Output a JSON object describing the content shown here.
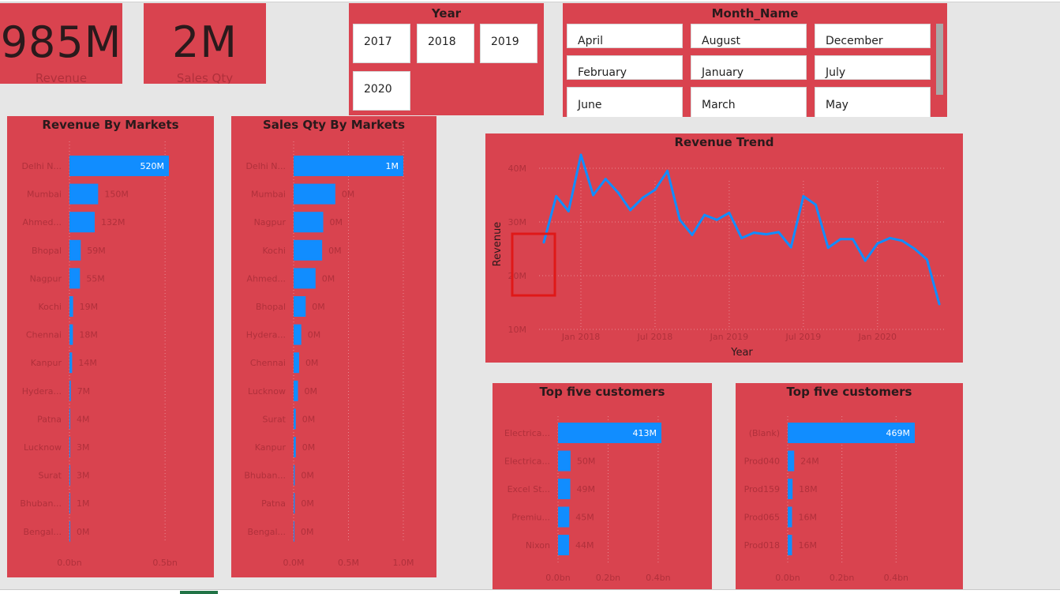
{
  "cards": [
    {
      "value": "985M",
      "label": "Revenue"
    },
    {
      "value": "2M",
      "label": "Sales Qty"
    }
  ],
  "year_slicer": {
    "title": "Year",
    "items": [
      "2017",
      "2018",
      "2019",
      "2020"
    ]
  },
  "month_slicer": {
    "title": "Month_Name",
    "items": [
      "April",
      "August",
      "December",
      "February",
      "January",
      "July",
      "June",
      "March",
      "May"
    ]
  },
  "colors": {
    "panel": "#d9434f",
    "bar": "#118dff",
    "line": "#118dff",
    "highlight": "#e01818",
    "axis_text": "#b0303b",
    "title": "#2a1a1c"
  },
  "chart_data": [
    {
      "id": "rev_markets",
      "type": "bar",
      "orientation": "horizontal",
      "title": "Revenue By Markets",
      "categories": [
        "Delhi N...",
        "Mumbai",
        "Ahmed...",
        "Bhopal",
        "Nagpur",
        "Kochi",
        "Chennai",
        "Kanpur",
        "Hydera...",
        "Patna",
        "Lucknow",
        "Surat",
        "Bhuban...",
        "Bengal..."
      ],
      "values": [
        520,
        150,
        132,
        59,
        55,
        19,
        18,
        14,
        7,
        4,
        3,
        3,
        1,
        0
      ],
      "data_labels": [
        "520M",
        "150M",
        "132M",
        "59M",
        "55M",
        "19M",
        "18M",
        "14M",
        "7M",
        "4M",
        "3M",
        "3M",
        "1M",
        "0M"
      ],
      "x_ticks": [
        {
          "value": 0,
          "label": "0.0bn"
        },
        {
          "value": 500,
          "label": "0.5bn"
        }
      ],
      "xlim": [
        0,
        520
      ],
      "grid": true
    },
    {
      "id": "qty_markets",
      "type": "bar",
      "orientation": "horizontal",
      "title": "Sales Qty By Markets",
      "categories": [
        "Delhi N...",
        "Mumbai",
        "Nagpur",
        "Kochi",
        "Ahmed...",
        "Bhopal",
        "Hydera...",
        "Chennai",
        "Lucknow",
        "Surat",
        "Kanpur",
        "Bhuban...",
        "Patna",
        "Bengal..."
      ],
      "values": [
        1.0,
        0.38,
        0.27,
        0.26,
        0.2,
        0.11,
        0.07,
        0.05,
        0.04,
        0.02,
        0.02,
        0.01,
        0.01,
        0.0
      ],
      "data_labels": [
        "1M",
        "0M",
        "0M",
        "0M",
        "0M",
        "0M",
        "0M",
        "0M",
        "0M",
        "0M",
        "0M",
        "0M",
        "0M",
        "0M"
      ],
      "x_ticks": [
        {
          "value": 0,
          "label": "0.0M"
        },
        {
          "value": 0.5,
          "label": "0.5M"
        },
        {
          "value": 1.0,
          "label": "1.0M"
        }
      ],
      "xlim": [
        0,
        1.0
      ],
      "grid": true
    },
    {
      "id": "rev_trend",
      "type": "line",
      "title": "Revenue Trend",
      "xlabel": "Year",
      "ylabel": "Revenue",
      "x_start": "2017-10",
      "x": [
        "2017-10",
        "2017-11",
        "2017-12",
        "2018-01",
        "2018-02",
        "2018-03",
        "2018-04",
        "2018-05",
        "2018-06",
        "2018-07",
        "2018-08",
        "2018-09",
        "2018-10",
        "2018-11",
        "2018-12",
        "2019-01",
        "2019-02",
        "2019-03",
        "2019-04",
        "2019-05",
        "2019-06",
        "2019-07",
        "2019-08",
        "2019-09",
        "2019-10",
        "2019-11",
        "2019-12",
        "2020-01",
        "2020-02",
        "2020-03",
        "2020-04",
        "2020-05",
        "2020-06"
      ],
      "values": [
        26.2,
        34.8,
        32.0,
        42.5,
        35.0,
        38.0,
        35.5,
        32.2,
        34.5,
        36.0,
        39.5,
        30.4,
        27.6,
        31.3,
        30.4,
        31.7,
        27.0,
        28.0,
        27.7,
        28.1,
        25.3,
        34.8,
        33.2,
        25.2,
        26.8,
        26.8,
        22.8,
        26.0,
        27.0,
        26.5,
        25.0,
        23.0,
        14.7
      ],
      "y_ticks": [
        {
          "value": 10,
          "label": "10M"
        },
        {
          "value": 20,
          "label": "20M"
        },
        {
          "value": 30,
          "label": "30M"
        },
        {
          "value": 40,
          "label": "40M"
        }
      ],
      "ylim": [
        10,
        40
      ],
      "x_ticks": [
        {
          "month": "2018-01",
          "label": "Jan 2018"
        },
        {
          "month": "2018-07",
          "label": "Jul 2018"
        },
        {
          "month": "2019-01",
          "label": "Jan 2019"
        },
        {
          "month": "2019-07",
          "label": "Jul 2019"
        },
        {
          "month": "2020-01",
          "label": "Jan 2020"
        }
      ],
      "grid": true
    },
    {
      "id": "top_customers",
      "type": "bar",
      "orientation": "horizontal",
      "title": "Top five customers",
      "categories": [
        "Electrica...",
        "Electrica...",
        "Excel St...",
        "Premiu...",
        "Nixon"
      ],
      "values": [
        413,
        50,
        49,
        45,
        44
      ],
      "data_labels": [
        "413M",
        "50M",
        "49M",
        "45M",
        "44M"
      ],
      "x_ticks": [
        {
          "value": 0,
          "label": "0.0bn"
        },
        {
          "value": 200,
          "label": "0.2bn"
        },
        {
          "value": 400,
          "label": "0.4bn"
        }
      ],
      "xlim": [
        0,
        413
      ],
      "grid": true
    },
    {
      "id": "top_products",
      "type": "bar",
      "orientation": "horizontal",
      "title": "Top five customers",
      "categories": [
        "(Blank)",
        "Prod040",
        "Prod159",
        "Prod065",
        "Prod018"
      ],
      "values": [
        469,
        24,
        18,
        16,
        16
      ],
      "data_labels": [
        "469M",
        "24M",
        "18M",
        "16M",
        "16M"
      ],
      "x_ticks": [
        {
          "value": 0,
          "label": "0.0bn"
        },
        {
          "value": 200,
          "label": "0.2bn"
        },
        {
          "value": 400,
          "label": "0.4bn"
        }
      ],
      "xlim": [
        0,
        469
      ],
      "grid": true
    }
  ]
}
